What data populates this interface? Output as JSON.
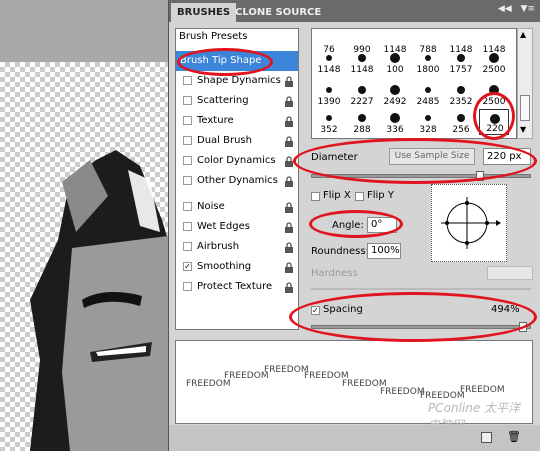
{
  "tabs": {
    "brushes": "BRUSHES",
    "clone_source": "CLONE SOURCE"
  },
  "panel_menu_icons": [
    "collapse-icon",
    "panel-menu-icon"
  ],
  "sidebar": {
    "presets": "Brush Presets",
    "items": [
      {
        "label": "Brush Tip Shape",
        "checked": null,
        "selected": true
      },
      {
        "label": "Shape Dynamics",
        "checked": false
      },
      {
        "label": "Scattering",
        "checked": false
      },
      {
        "label": "Texture",
        "checked": false
      },
      {
        "label": "Dual Brush",
        "checked": false
      },
      {
        "label": "Color Dynamics",
        "checked": false
      },
      {
        "label": "Other Dynamics",
        "checked": false
      },
      {
        "label": "Noise",
        "checked": false
      },
      {
        "label": "Wet Edges",
        "checked": false
      },
      {
        "label": "Airbrush",
        "checked": false
      },
      {
        "label": "Smoothing",
        "checked": true
      },
      {
        "label": "Protect Texture",
        "checked": false
      }
    ]
  },
  "brush_tips": {
    "rows": [
      [
        "76",
        "990",
        "1148",
        "788",
        "1148",
        "1148"
      ],
      [
        "1148",
        "1148",
        "100",
        "1800",
        "1757",
        "2500"
      ],
      [
        "1390",
        "2227",
        "2492",
        "2485",
        "2352",
        "2500"
      ],
      [
        "352",
        "288",
        "336",
        "328",
        "256",
        "220"
      ]
    ]
  },
  "diameter": {
    "label": "Diameter",
    "button": "Use Sample Size",
    "value": "220 px",
    "slider_fraction": 0.78
  },
  "flip": {
    "x_label": "Flip X",
    "y_label": "Flip Y"
  },
  "angle": {
    "label": "Angle:",
    "value": "0°"
  },
  "roundness": {
    "label": "Roundness:",
    "value": "100%"
  },
  "hardness": {
    "label": "Hardness"
  },
  "spacing": {
    "label": "Spacing",
    "value": "494%",
    "checked": true,
    "slider_fraction": 0.98
  },
  "preview": {
    "stroke_word": "FREEDOM"
  },
  "footer_icons": [
    "new-brush-icon",
    "delete-brush-icon"
  ],
  "watermark": "PConline 太平洋电脑网"
}
